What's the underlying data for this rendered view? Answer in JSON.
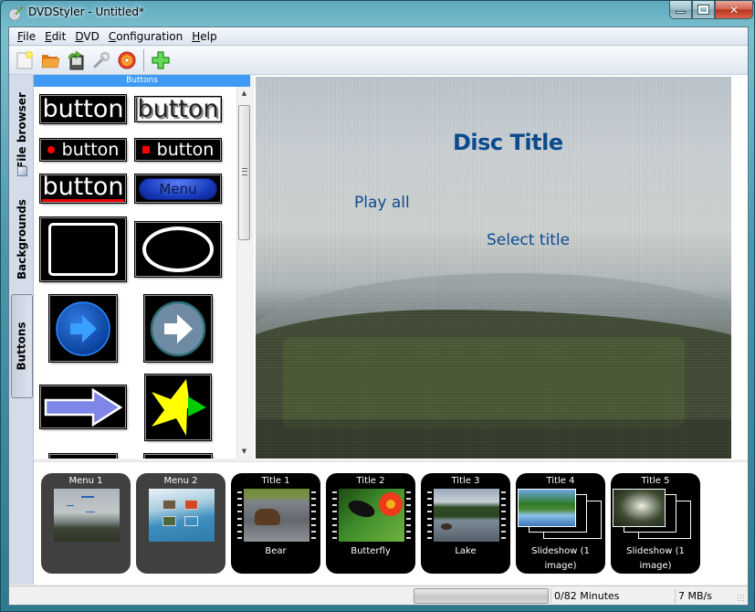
{
  "window": {
    "title": "DVDStyler - Untitled*",
    "controls": {
      "minimize": "–",
      "maximize": "□",
      "close": "✕"
    }
  },
  "menubar": {
    "items": [
      {
        "label_underline": "F",
        "label_rest": "ile"
      },
      {
        "label_underline": "E",
        "label_rest": "dit"
      },
      {
        "label_underline": "D",
        "label_rest": "VD"
      },
      {
        "label_underline": "C",
        "label_rest": "onfiguration"
      },
      {
        "label_underline": "H",
        "label_rest": "elp"
      }
    ]
  },
  "toolbar": {
    "buttons": [
      {
        "icon": "new-document-icon"
      },
      {
        "icon": "open-folder-icon"
      },
      {
        "icon": "save-icon"
      },
      {
        "icon": "settings-wrench-icon"
      },
      {
        "icon": "burn-disc-icon"
      },
      {
        "icon": "add-file-icon"
      }
    ]
  },
  "side_tabs": [
    {
      "label": "File browser",
      "active": false
    },
    {
      "label": "Backgrounds",
      "active": false
    },
    {
      "label": "Buttons",
      "active": true
    }
  ],
  "buttons_panel": {
    "header": "Buttons",
    "items": [
      {
        "kind": "text",
        "label": "button"
      },
      {
        "kind": "text-outline",
        "label": "button"
      },
      {
        "kind": "dot",
        "label": "button"
      },
      {
        "kind": "square",
        "label": "button"
      },
      {
        "kind": "underline",
        "label": "button"
      },
      {
        "kind": "oval",
        "label": "Menu"
      },
      {
        "kind": "rect-frame",
        "label": ""
      },
      {
        "kind": "ellipse-frame",
        "label": ""
      },
      {
        "kind": "blue-circle-arrow",
        "label": ""
      },
      {
        "kind": "grey-circle-arrow",
        "label": ""
      },
      {
        "kind": "purple-arrow",
        "label": ""
      },
      {
        "kind": "star-arrow",
        "label": ""
      }
    ]
  },
  "canvas": {
    "disc_title": "Disc Title",
    "play_all": "Play all",
    "select_title": "Select title",
    "text_color": "#0c4a8e"
  },
  "titleset": {
    "tiles": [
      {
        "type": "menu",
        "label": "Menu 1",
        "caption": ""
      },
      {
        "type": "menu",
        "label": "Menu 2",
        "caption": ""
      },
      {
        "type": "video",
        "label": "Title 1",
        "caption": "Bear"
      },
      {
        "type": "video",
        "label": "Title 2",
        "caption": "Butterfly"
      },
      {
        "type": "video",
        "label": "Title 3",
        "caption": "Lake"
      },
      {
        "type": "slideshow",
        "label": "Title 4",
        "caption": "Slideshow (1 image)"
      },
      {
        "type": "slideshow",
        "label": "Title 5",
        "caption": "Slideshow (1 image)"
      }
    ]
  },
  "statusbar": {
    "progress_fraction": 0,
    "duration": "0/82 Minutes",
    "bitrate": "7 MB/s"
  }
}
